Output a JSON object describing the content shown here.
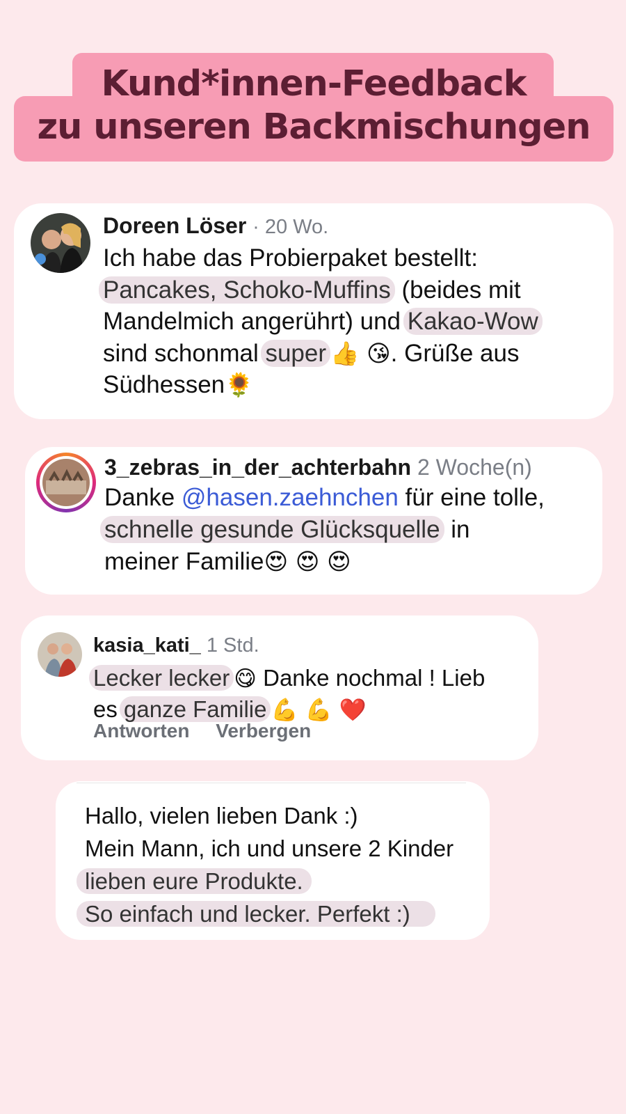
{
  "title": {
    "line1": "Kund*innen-Feedback",
    "line2": "zu unseren Backmischungen"
  },
  "comments": [
    {
      "name": "Doreen Löser",
      "time": "· 20 Wo.",
      "line1": "Ich habe das Probierpaket bestellt:",
      "hl1": "Pancakes, Schoko-Muffins",
      "line2b": " (beides mit",
      "line3a": "Mandelmich angerührt) und ",
      "hl2": "Kakao-Wow",
      "line4a": "sind schonmal ",
      "hl3": "super",
      "emoji1": "👍 😘",
      "line4b": ". Grüße aus",
      "line5a": "Südhessen",
      "emoji2": "🌻"
    },
    {
      "name": "3_zebras_in_der_achterbahn",
      "time": "2 Woche(n)",
      "line1a": "Danke ",
      "mention": "@hasen.zaehnchen",
      "line1b": " für eine tolle,",
      "hl1": "schnelle gesunde Glücksquelle",
      "line2b": " in",
      "line3a": "meiner Familie",
      "emoji1": "😍 😍 😍"
    },
    {
      "name": "kasia_kati_",
      "time": "1 Std.",
      "hl1": "Lecker lecker",
      "emoji1": "😋",
      "line1b": " Danke nochmal ! Lieb",
      "line2a": "es ",
      "hl2": "ganze Familie",
      "emoji2": "💪 💪 ❤️",
      "action_reply": "Antworten",
      "action_hide": "Verbergen"
    },
    {
      "line1": "Hallo, vielen lieben Dank :)",
      "line2": "Mein Mann, ich und unsere 2 Kinder",
      "hl1": "lieben eure Produkte.",
      "hl2": "So einfach und lecker. Perfekt :)"
    }
  ],
  "colors": {
    "background": "#fde9ec",
    "title_bg": "#f79cb4",
    "title_text": "#5c1e33",
    "highlight": "#ece0e6",
    "mention": "#3b5bd6"
  }
}
